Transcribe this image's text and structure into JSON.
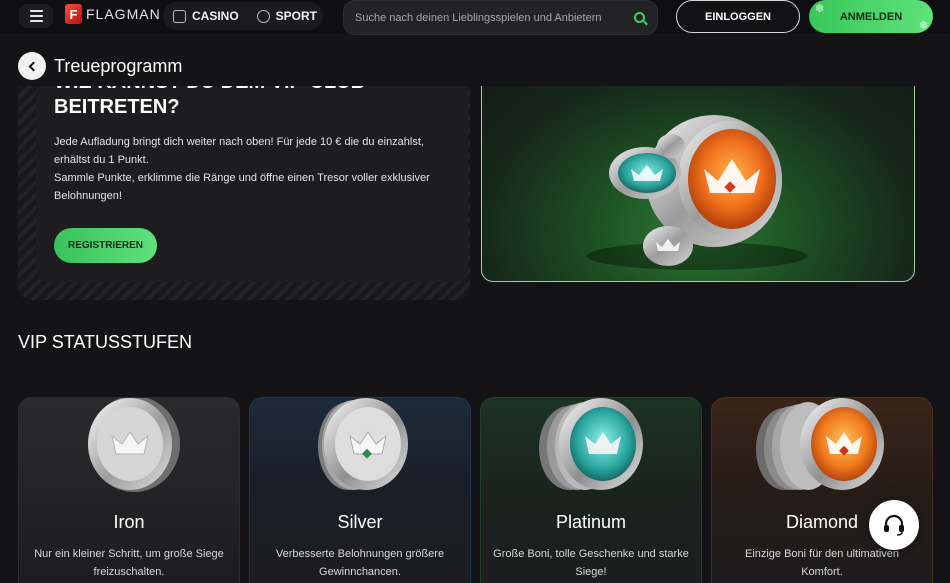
{
  "header": {
    "logo_text": "FLAGMAN",
    "nav": [
      {
        "label": "CASINO",
        "icon": "casino-icon"
      },
      {
        "label": "SPORT",
        "icon": "sport-icon"
      }
    ],
    "search_placeholder": "Suche nach deinen Lieblingsspielen und Anbietern",
    "login_label": "EINLOGGEN",
    "register_label": "ANMELDEN"
  },
  "page": {
    "title": "Treueprogramm"
  },
  "hero": {
    "heading": "WIE KANNST DU DEM VIP-CLUB BEITRETEN?",
    "text_line1": "Jede Aufladung bringt dich weiter nach oben! Für jede 10 € die du einzahlst, erhältst du 1 Punkt.",
    "text_line2": "Sammle Punkte, erklimme die Ränge und öffne einen Tresor voller exklusiver Belohnungen!",
    "cta_label": "REGISTRIEREN"
  },
  "vip": {
    "section_title": "VIP STATUSSTUFEN",
    "tiers": [
      {
        "name": "Iron",
        "description": "Nur ein kleiner Schritt, um große Siege freizuschalten.",
        "accent": "#9a9a9a"
      },
      {
        "name": "Silver",
        "description": "Verbesserte Belohnungen größere Gewinnchancen.",
        "accent": "#2b5a8a"
      },
      {
        "name": "Platinum",
        "description": "Große Boni, tolle Geschenke und starke Siege!",
        "accent": "#1f7a3a"
      },
      {
        "name": "Diamond",
        "description": "Einzige Boni für den ultimativen Komfort.",
        "accent": "#c3521d"
      }
    ]
  },
  "colors": {
    "background": "#141416",
    "accent_green": "#4fd66c"
  }
}
